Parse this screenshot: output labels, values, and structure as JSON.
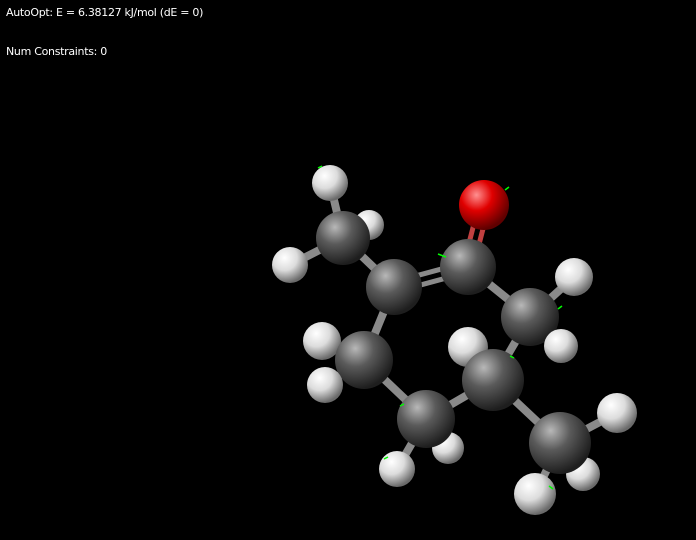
{
  "overlay": {
    "energy_text": "AutoOpt: E = 6.38127 kJ/mol (dE = 0)",
    "constraints_text": "Num Constraints: 0"
  },
  "colors": {
    "background": "#000000",
    "carbon": "#5a5a5a",
    "hydrogen": "#f0f0f0",
    "oxygen": "#e00000",
    "bond": "#8a8a8a",
    "force_vector": "#00ff00"
  }
}
